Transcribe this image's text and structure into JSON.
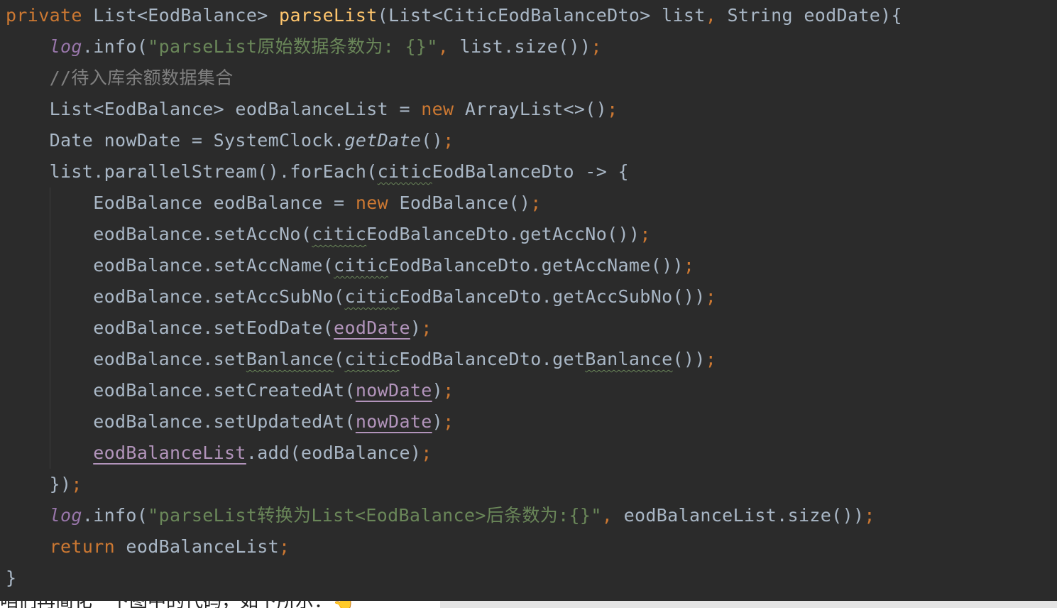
{
  "code_lines": [
    "private List<EodBalance> parseList(List<CiticEodBalanceDto> list, String eodDate){",
    "    log.info(\"parseList原始数据条数为: {}\", list.size());",
    "    //待入库余额数据集合",
    "    List<EodBalance> eodBalanceList = new ArrayList<>();",
    "    Date nowDate = SystemClock.getDate();",
    "    list.parallelStream().forEach(citicEodBalanceDto -> {",
    "        EodBalance eodBalance = new EodBalance();",
    "        eodBalance.setAccNo(citicEodBalanceDto.getAccNo());",
    "        eodBalance.setAccName(citicEodBalanceDto.getAccName());",
    "        eodBalance.setAccSubNo(citicEodBalanceDto.getAccSubNo());",
    "        eodBalance.setEodDate(eodDate);",
    "        eodBalance.setBanlance(citicEodBalanceDto.getBanlance());",
    "        eodBalance.setCreatedAt(nowDate);",
    "        eodBalance.setUpdatedAt(nowDate);",
    "        eodBalanceList.add(eodBalance);",
    "    });",
    "    log.info(\"parseList转换为List<EodBalance>后条数为:{}\", eodBalanceList.size());",
    "    return eodBalanceList;",
    "}"
  ],
  "footer_text": "咱们再简化一下图中的代码，如下所示：👆",
  "colors": {
    "background": "#2b2b2b",
    "default": "#a9b7c6",
    "keyword": "#cc7832",
    "method_decl": "#ffc66d",
    "string": "#6a8759",
    "comment": "#808080",
    "static_field": "#9876aa"
  }
}
